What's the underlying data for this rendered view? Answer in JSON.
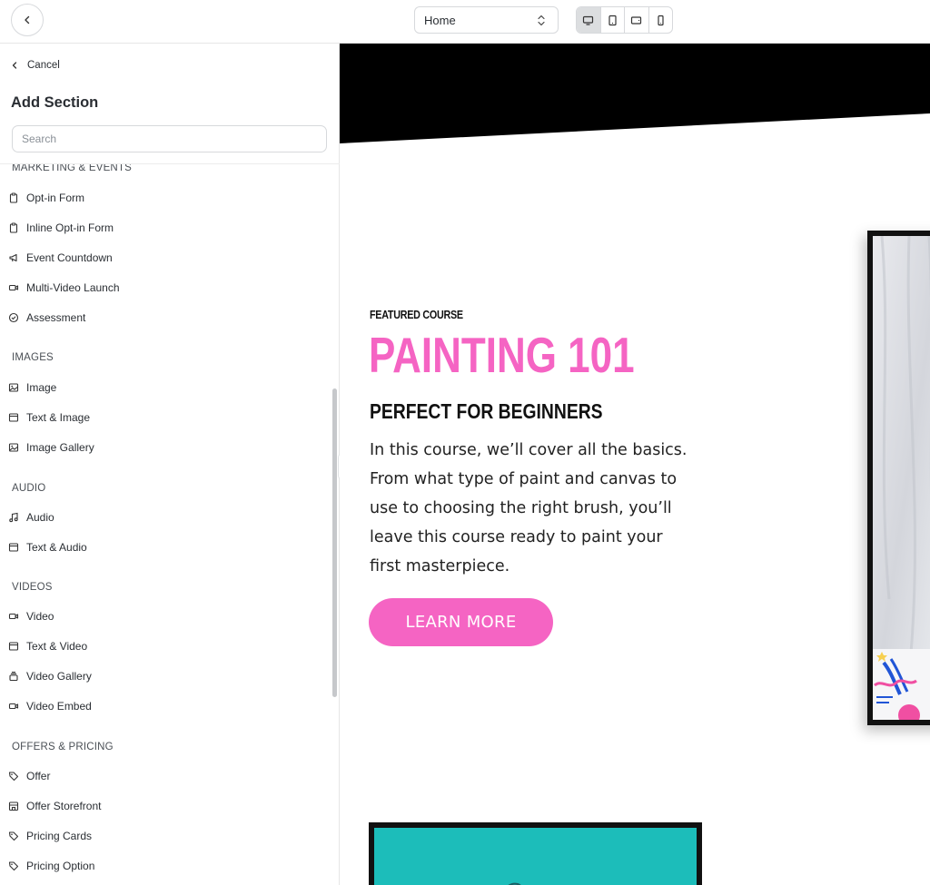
{
  "topbar": {
    "back_icon": "chevron-left-icon",
    "page_select": {
      "value": "Home",
      "icon": "select-arrows-icon"
    },
    "devices": [
      {
        "name": "desktop",
        "icon": "desktop-icon",
        "active": true
      },
      {
        "name": "tablet-portrait",
        "icon": "tablet-portrait-icon",
        "active": false
      },
      {
        "name": "tablet-landscape",
        "icon": "tablet-landscape-icon",
        "active": false
      },
      {
        "name": "mobile",
        "icon": "mobile-icon",
        "active": false
      }
    ]
  },
  "sidebar": {
    "cancel_label": "Cancel",
    "title": "Add Section",
    "search": {
      "placeholder": "Search",
      "value": ""
    },
    "categories": [
      {
        "label": "MARKETING & EVENTS",
        "items": [
          {
            "label": "Opt-in Form",
            "icon": "clipboard-icon"
          },
          {
            "label": "Inline Opt-in Form",
            "icon": "clipboard-icon"
          },
          {
            "label": "Event Countdown",
            "icon": "megaphone-icon"
          },
          {
            "label": "Multi-Video Launch",
            "icon": "video-camera-icon"
          },
          {
            "label": "Assessment",
            "icon": "check-badge-icon"
          }
        ]
      },
      {
        "label": "IMAGES",
        "items": [
          {
            "label": "Image",
            "icon": "image-icon"
          },
          {
            "label": "Text & Image",
            "icon": "layout-icon"
          },
          {
            "label": "Image Gallery",
            "icon": "image-icon"
          }
        ]
      },
      {
        "label": "AUDIO",
        "items": [
          {
            "label": "Audio",
            "icon": "music-note-icon"
          },
          {
            "label": "Text & Audio",
            "icon": "layout-icon"
          }
        ]
      },
      {
        "label": "VIDEOS",
        "items": [
          {
            "label": "Video",
            "icon": "video-camera-icon"
          },
          {
            "label": "Text & Video",
            "icon": "layout-icon"
          },
          {
            "label": "Video Gallery",
            "icon": "stack-icon"
          },
          {
            "label": "Video Embed",
            "icon": "video-camera-icon"
          }
        ]
      },
      {
        "label": "OFFERS & PRICING",
        "items": [
          {
            "label": "Offer",
            "icon": "tag-icon"
          },
          {
            "label": "Offer Storefront",
            "icon": "storefront-icon"
          },
          {
            "label": "Pricing Cards",
            "icon": "tag-icon"
          },
          {
            "label": "Pricing Option",
            "icon": "tag-icon"
          }
        ]
      }
    ]
  },
  "preview": {
    "eyebrow": "FEATURED COURSE",
    "title": "PAINTING 101",
    "subtitle": "PERFECT FOR BEGINNERS",
    "body_lines": [
      "In this course, we’ll cover all the basics.",
      "From what type of paint and canvas to",
      "use to choosing the right brush, you’ll",
      "leave this course ready to paint your",
      "first masterpiece."
    ],
    "cta_label": "LEARN MORE",
    "colors": {
      "accent": "#f564c3",
      "band": "#000000",
      "teal": "#1fc4c0"
    }
  }
}
